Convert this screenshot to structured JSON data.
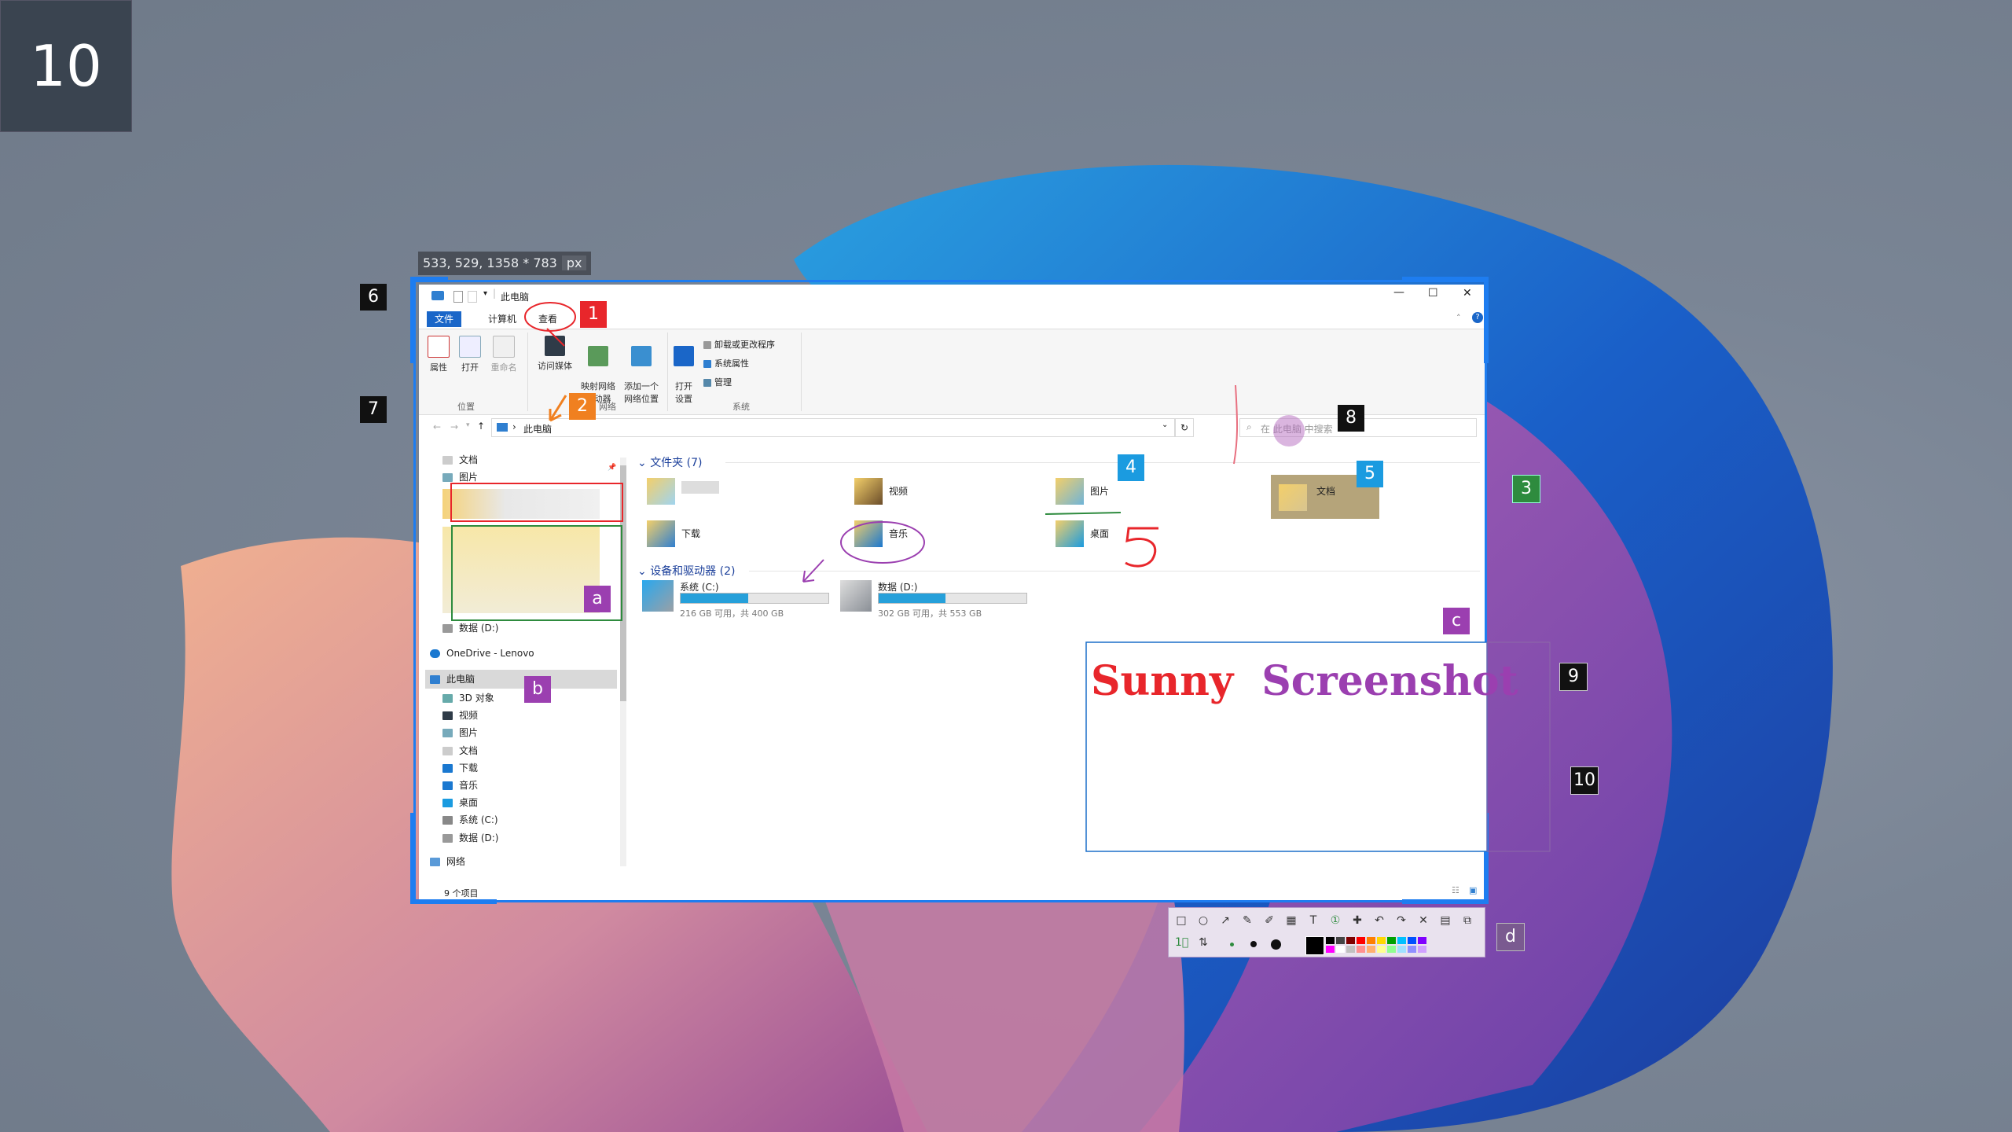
{
  "desktop": {
    "step_number": "10",
    "selection_info": {
      "coords": "533, 529, 1358 * 783",
      "unit": "px"
    }
  },
  "explorer": {
    "title": "此电脑",
    "window_controls": {
      "minimize": "—",
      "maximize": "☐",
      "close": "✕"
    },
    "tabs": [
      {
        "label": "文件"
      },
      {
        "label": "计算机"
      },
      {
        "label": "查看"
      }
    ],
    "ribbon": {
      "location_group": {
        "title": "位置",
        "buttons": [
          "属性",
          "打开",
          "重命名"
        ]
      },
      "network_group": {
        "title": "网络",
        "buttons": [
          "访问媒体",
          "映射网络\n驱动器",
          "添加一个\n网络位置"
        ]
      },
      "system_group": {
        "title": "系统",
        "open_settings": "打开\n设置",
        "items": [
          "卸载或更改程序",
          "系统属性",
          "管理"
        ]
      }
    },
    "address": {
      "path": "此电脑",
      "search_placeholder": "在 此电脑 中搜索"
    },
    "nav_pane": {
      "quick_access": [
        {
          "label": "文档"
        },
        {
          "label": "图片"
        }
      ],
      "other": [
        {
          "label": "数据 (D:)"
        },
        {
          "label": "OneDrive - Lenovo"
        },
        {
          "label": "此电脑"
        }
      ],
      "this_pc_children": [
        {
          "label": "3D 对象"
        },
        {
          "label": "视频"
        },
        {
          "label": "图片"
        },
        {
          "label": "文档"
        },
        {
          "label": "下载"
        },
        {
          "label": "音乐"
        },
        {
          "label": "桌面"
        },
        {
          "label": "系统 (C:)"
        },
        {
          "label": "数据 (D:)"
        },
        {
          "label": "网络"
        }
      ]
    },
    "folders_section": {
      "title": "文件夹 (7)",
      "items": [
        {
          "label": "视频"
        },
        {
          "label": "图片"
        },
        {
          "label": "文档"
        },
        {
          "label": "下载"
        },
        {
          "label": "音乐"
        },
        {
          "label": "桌面"
        }
      ]
    },
    "drives_section": {
      "title": "设备和驱动器 (2)",
      "drives": [
        {
          "name": "系统 (C:)",
          "info": "216 GB 可用，共 400 GB",
          "used_fraction": 0.46
        },
        {
          "name": "数据 (D:)",
          "info": "302 GB 可用，共 553 GB",
          "used_fraction": 0.454
        }
      ]
    },
    "status": {
      "count": "9 个项目"
    }
  },
  "annotations": {
    "markers": [
      "1",
      "2",
      "3",
      "4",
      "5",
      "6",
      "7",
      "8",
      "9",
      "10",
      "a",
      "b",
      "c",
      "d"
    ],
    "handwritten": "5",
    "text_box": {
      "word1": "Sunny",
      "word2": "Screenshot"
    }
  },
  "colors": {
    "selection": "#1e7df0",
    "red": "#e8262b",
    "orange": "#f08020",
    "green": "#2e8b3e",
    "blue": "#1b9be0",
    "purple": "#9b3fb0",
    "black": "#111111",
    "tan": "#b5a47a"
  },
  "palette": [
    "#000000",
    "#444444",
    "#7f0000",
    "#ff0000",
    "#ff7f00",
    "#ffd700",
    "#00a000",
    "#00c0ff",
    "#0050ff",
    "#8000ff",
    "#ff00ff",
    "#ffffff",
    "#c0c0c0",
    "#ff9090",
    "#ffb070",
    "#ffff90",
    "#90ff90",
    "#a0e0ff",
    "#9090ff",
    "#d0a0ff"
  ]
}
